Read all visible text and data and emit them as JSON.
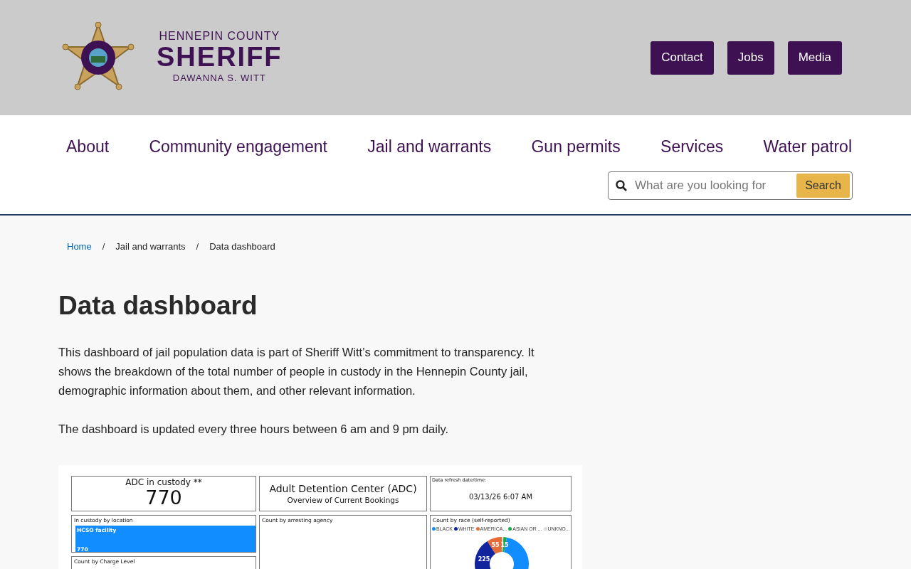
{
  "header": {
    "logo": {
      "line1": "HENNEPIN COUNTY",
      "line2": "SHERIFF",
      "line3": "DAWANNA S. WITT"
    },
    "buttons": [
      "Contact",
      "Jobs",
      "Media"
    ]
  },
  "nav": {
    "items": [
      "About",
      "Community engagement",
      "Jail and warrants",
      "Gun permits",
      "Services",
      "Water patrol"
    ],
    "search": {
      "placeholder": "What are you looking for",
      "button": "Search"
    }
  },
  "breadcrumb_separator": "/",
  "breadcrumbs": [
    {
      "label": "Home",
      "kind": "link"
    },
    {
      "label": "Jail and warrants",
      "kind": "text"
    },
    {
      "label": "Data dashboard",
      "kind": "text"
    }
  ],
  "page": {
    "title": "Data dashboard",
    "paragraphs": [
      "This dashboard of jail population data is part of Sheriff Witt’s commitment to transparency. It shows the breakdown of the total number of people in custody in the Hennepin County jail, demographic information about them, and other relevant information.",
      "The dashboard is updated every three hours between 6 am and 9 pm daily."
    ]
  },
  "dashboard": {
    "custody": {
      "title": "ADC in custody **",
      "value": "770"
    },
    "heading": {
      "title": "Adult Detention Center (ADC)",
      "subtitle": "Overview of Current Bookings"
    },
    "refresh": {
      "label": "Data refresh date/time:",
      "value": "03/13/26 6:07 AM"
    },
    "location": {
      "title": "In custody by location",
      "bar_label": "HCSO facility",
      "bar_value": "770",
      "level": 1
    },
    "agency": {
      "title": "Count by arresting agency"
    },
    "charge": {
      "title": "Count by Charge Level"
    },
    "race": {
      "title": "Count by race (self-reported)",
      "legend": [
        {
          "label": "BLACK",
          "color": "#118dff"
        },
        {
          "label": "WHITE",
          "color": "#12239e"
        },
        {
          "label": "AMERICA...",
          "color": "#e66c37"
        },
        {
          "label": "ASIAN OR ...",
          "color": "#1aab40"
        },
        {
          "label": "UNKNO...",
          "color": "#d9d9d9"
        }
      ],
      "slice_labels": [
        "225",
        "55",
        "15"
      ]
    }
  }
}
